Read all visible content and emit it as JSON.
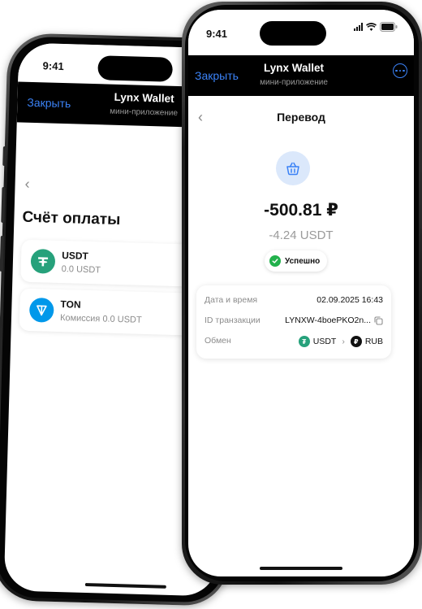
{
  "back_phone": {
    "time": "9:41",
    "header": {
      "close_label": "Закрыть",
      "title": "Lynx Wallet",
      "subtitle": "мини-приложение"
    },
    "page_title": "Счёт оплаты",
    "assets": [
      {
        "name": "USDT",
        "sub": "0.0 USDT",
        "icon": "tether-icon",
        "color": "#26a17b"
      },
      {
        "name": "TON",
        "sub": "Комиссия 0.0 USDT",
        "icon": "ton-icon",
        "color": "#0098ea"
      }
    ]
  },
  "front_phone": {
    "time": "9:41",
    "header": {
      "close_label": "Закрыть",
      "title": "Lynx Wallet",
      "subtitle": "мини-приложение"
    },
    "page_title": "Перевод",
    "amount_rub": "-500.81 ₽",
    "amount_usdt": "-4.24 USDT",
    "status": "Успешно",
    "details": {
      "date_label": "Дата и время",
      "date_value": "02.09.2025 16:43",
      "id_label": "ID транзакции",
      "id_value": "LYNXW-4boePKO2n...",
      "exchange_label": "Обмен",
      "exchange_from": "USDT",
      "exchange_to": "RUB"
    },
    "colors": {
      "accent": "#3b82f6",
      "success": "#22b14c",
      "usdt": "#26a17b"
    }
  }
}
